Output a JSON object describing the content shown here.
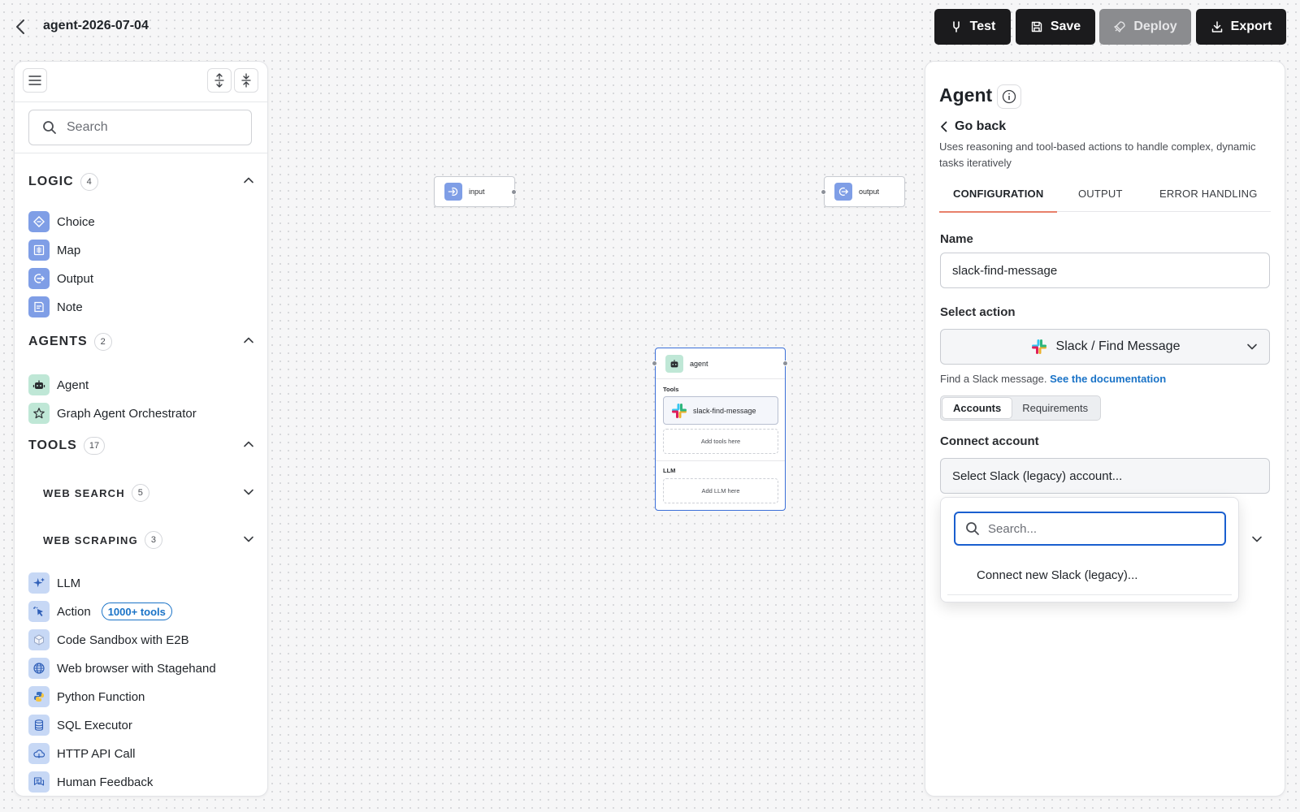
{
  "header": {
    "title": "agent-2026-07-04",
    "buttons": {
      "test": "Test",
      "save": "Save",
      "deploy": "Deploy",
      "export": "Export"
    }
  },
  "left_panel": {
    "search_placeholder": "Search",
    "sections": {
      "logic": {
        "label": "LOGIC",
        "count": "4",
        "items": [
          "Choice",
          "Map",
          "Output",
          "Note"
        ]
      },
      "agents": {
        "label": "AGENTS",
        "count": "2",
        "items": [
          "Agent",
          "Graph Agent Orchestrator"
        ]
      },
      "tools": {
        "label": "TOOLS",
        "count": "17",
        "web_search": {
          "label": "WEB SEARCH",
          "count": "5"
        },
        "web_scraping": {
          "label": "WEB SCRAPING",
          "count": "3"
        },
        "items": [
          "LLM",
          "Action",
          "Code Sandbox with E2B",
          "Web browser with Stagehand",
          "Python Function",
          "SQL Executor",
          "HTTP API Call",
          "Human Feedback"
        ],
        "action_badge": "1000+ tools"
      }
    }
  },
  "canvas": {
    "input_node": "input",
    "output_node": "output",
    "agent_node": {
      "title": "agent",
      "tools_label": "Tools",
      "tool": "slack-find-message",
      "add_tools": "Add tools here",
      "llm_label": "LLM",
      "add_llm": "Add LLM here"
    }
  },
  "right_panel": {
    "title": "Agent",
    "go_back": "Go back",
    "description": "Uses reasoning and tool-based actions to handle complex, dynamic tasks iteratively",
    "tabs": [
      "CONFIGURATION",
      "OUTPUT",
      "ERROR HANDLING"
    ],
    "name_label": "Name",
    "name_value": "slack-find-message",
    "select_action_label": "Select action",
    "selected_action": "Slack / Find Message",
    "help_text": "Find a Slack message.",
    "help_link": "See the documentation",
    "segments": [
      "Accounts",
      "Requirements"
    ],
    "connect_account_label": "Connect account",
    "account_placeholder": "Select Slack (legacy) account...",
    "dropdown": {
      "search_placeholder": "Search...",
      "connect_new": "Connect new Slack (legacy)..."
    }
  },
  "colors": {
    "primary_button": "#1b1b1d",
    "link": "#1a73c7",
    "selected_node_border": "#3b6fd8",
    "active_tab_underline": "#e8806a"
  }
}
